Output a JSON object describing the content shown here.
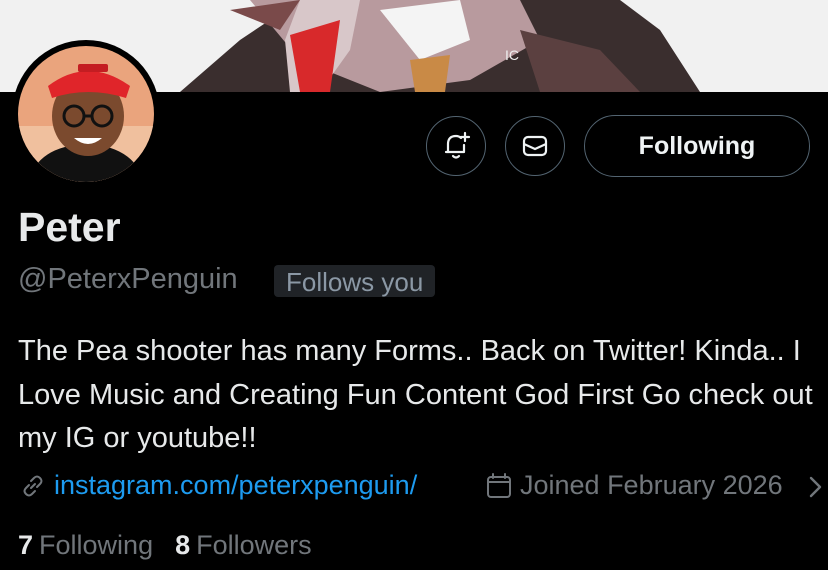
{
  "profile": {
    "name": "Peter",
    "handle": "@PeterxPenguin",
    "follows_you": "Follows you",
    "bio": "The Pea shooter has many Forms.. Back on Twitter! Kinda.. I Love Music and Creating Fun Content God First Go check out my IG or youtube!!",
    "link": "instagram.com/peterxpenguin/",
    "joined": "Joined February 2026"
  },
  "actions": {
    "follow_label": "Following",
    "notify_icon": "bell-plus-icon",
    "message_icon": "envelope-icon"
  },
  "stats": {
    "following_count": "7",
    "following_label": "Following",
    "followers_count": "8",
    "followers_label": "Followers"
  },
  "colors": {
    "background": "#000000",
    "link": "#1d9bf0",
    "muted": "#71767b",
    "text": "#e7e9ea",
    "border": "#536471"
  }
}
